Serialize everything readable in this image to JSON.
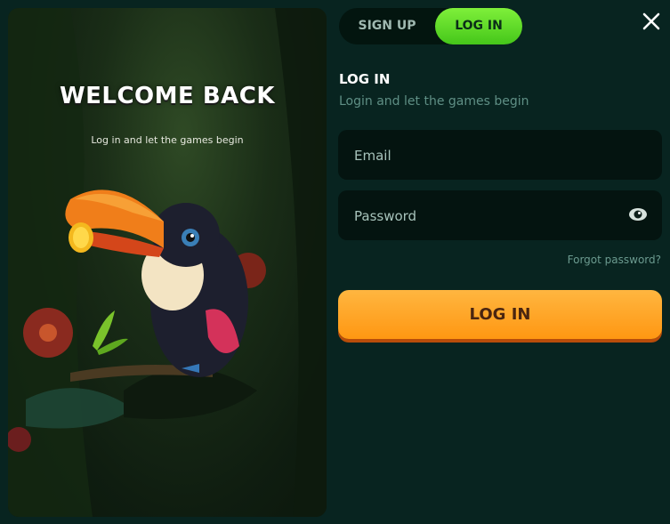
{
  "hero": {
    "title": "WELCOME BACK",
    "subtitle": "Log in and let the games begin"
  },
  "tabs": [
    {
      "label": "SIGN UP",
      "active": false
    },
    {
      "label": "LOG IN",
      "active": true
    }
  ],
  "close_icon": "close-icon",
  "form": {
    "title": "LOG IN",
    "subtitle": "Login and let the games begin",
    "email_placeholder": "Email",
    "password_placeholder": "Password",
    "forgot_label": "Forgot password?",
    "submit_label": "LOG IN"
  },
  "colors": {
    "background": "#082420",
    "accent_green": "#52cf1e",
    "button_orange": "#ff9c1a",
    "input_bg": "#041410"
  }
}
